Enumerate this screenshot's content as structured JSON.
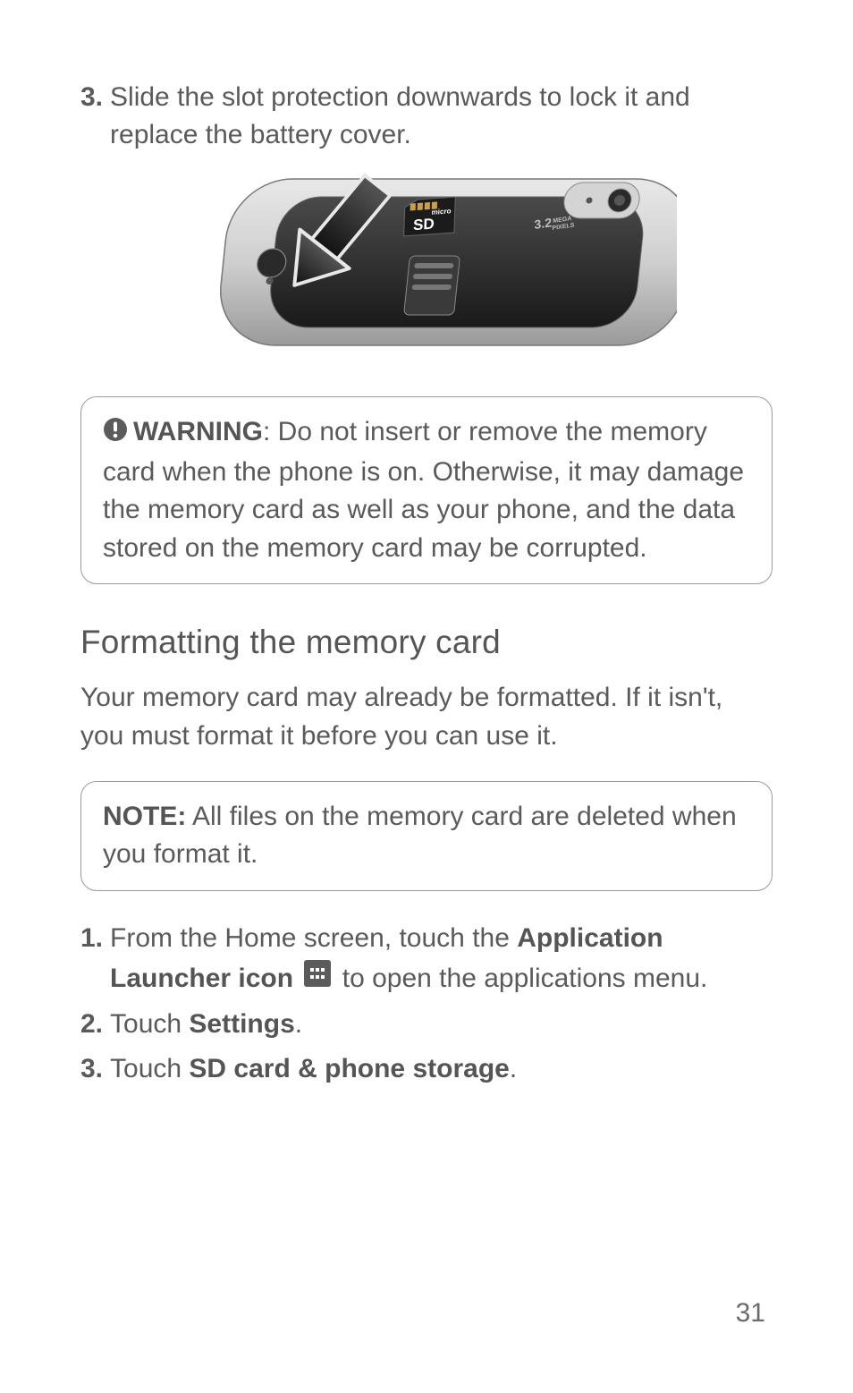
{
  "top_step": {
    "num": "3.",
    "text": "Slide the slot protection downwards to lock it and replace the battery cover."
  },
  "warning": {
    "label": "WARNING",
    "text": ": Do not insert or remove the memory card when the phone is on. Otherwise, it may damage the memory card as well as your phone, and the data stored on the memory card may be corrupted."
  },
  "section_title": "Formatting the memory card",
  "section_body": "Your memory card may already be formatted. If it isn't, you must format it before you can use it.",
  "note": {
    "label": "NOTE:",
    "text": " All files on the memory card are deleted when you format it."
  },
  "steps": [
    {
      "num": "1.",
      "pre": "From the Home screen, touch the ",
      "bold1": "Application Launcher icon",
      "post": " to open the applications menu."
    },
    {
      "num": "2.",
      "pre": "Touch ",
      "bold1": "Settings",
      "post": "."
    },
    {
      "num": "3.",
      "pre": "Touch ",
      "bold1": "SD card & phone storage",
      "post": "."
    }
  ],
  "icons": {
    "warning": "exclamation-circle-icon",
    "launcher": "app-launcher-icon"
  },
  "figure": {
    "labels": {
      "sd": "SD",
      "micro": "micro",
      "mega": "MEGA",
      "pixels": "PIXELS",
      "mp": "3.2"
    }
  },
  "page_number": "31"
}
